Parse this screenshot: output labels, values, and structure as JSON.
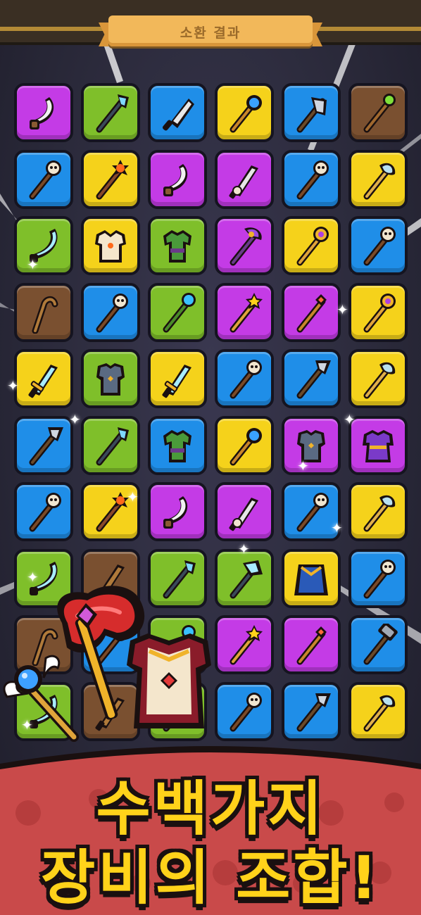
{
  "header": {
    "title": "소환 결과"
  },
  "headline": {
    "line1": "수백가지",
    "line2": "장비의 조합!"
  },
  "colors": {
    "purple": "#c43be6",
    "green": "#7fbf2a",
    "blue": "#1f8ee8",
    "yellow": "#f5d21b",
    "brown": "#7a5030",
    "banner": "#c94a4a",
    "headline": "#ffd21a"
  },
  "grid": {
    "rows": [
      [
        {
          "color": "purple",
          "item": "scimitar-icon"
        },
        {
          "color": "green",
          "item": "ice-spear-icon"
        },
        {
          "color": "blue",
          "item": "cleaver-icon"
        },
        {
          "color": "yellow",
          "item": "star-scepter-icon"
        },
        {
          "color": "blue",
          "item": "axe-icon"
        },
        {
          "color": "brown",
          "item": "green-orb-staff-icon"
        }
      ],
      [
        {
          "color": "blue",
          "item": "skull-staff-icon"
        },
        {
          "color": "yellow",
          "item": "sun-scepter-icon"
        },
        {
          "color": "purple",
          "item": "scimitar-icon"
        },
        {
          "color": "purple",
          "item": "skull-sword-icon"
        },
        {
          "color": "blue",
          "item": "skull-staff-icon"
        },
        {
          "color": "yellow",
          "item": "battle-axe-icon"
        }
      ],
      [
        {
          "color": "green",
          "item": "ice-scimitar-icon"
        },
        {
          "color": "yellow",
          "item": "armor-icon"
        },
        {
          "color": "green",
          "item": "tunic-icon"
        },
        {
          "color": "purple",
          "item": "orb-axe-staff-icon"
        },
        {
          "color": "yellow",
          "item": "moon-wand-icon"
        },
        {
          "color": "blue",
          "item": "skull-staff-icon"
        }
      ],
      [
        {
          "color": "brown",
          "item": "crook-staff-icon"
        },
        {
          "color": "blue",
          "item": "skull-staff-icon"
        },
        {
          "color": "green",
          "item": "vine-orb-staff-icon"
        },
        {
          "color": "purple",
          "item": "star-wand-icon"
        },
        {
          "color": "purple",
          "item": "winged-wand-icon"
        },
        {
          "color": "yellow",
          "item": "moon-wand-icon"
        }
      ],
      [
        {
          "color": "yellow",
          "item": "gold-sword-icon"
        },
        {
          "color": "green",
          "item": "chestplate-icon"
        },
        {
          "color": "yellow",
          "item": "gold-sword-icon"
        },
        {
          "color": "blue",
          "item": "skull-staff-icon"
        },
        {
          "color": "blue",
          "item": "spear-icon"
        },
        {
          "color": "yellow",
          "item": "battle-axe-icon"
        }
      ],
      [
        {
          "color": "blue",
          "item": "spear-icon"
        },
        {
          "color": "green",
          "item": "ice-spear-icon"
        },
        {
          "color": "blue",
          "item": "tunic-icon"
        },
        {
          "color": "yellow",
          "item": "star-scepter-icon"
        },
        {
          "color": "purple",
          "item": "chestplate-icon"
        },
        {
          "color": "purple",
          "item": "robe-icon"
        }
      ],
      [
        {
          "color": "blue",
          "item": "skull-staff-icon"
        },
        {
          "color": "yellow",
          "item": "sun-scepter-icon"
        },
        {
          "color": "purple",
          "item": "scimitar-icon"
        },
        {
          "color": "purple",
          "item": "skull-sword-icon"
        },
        {
          "color": "blue",
          "item": "skull-staff-icon"
        },
        {
          "color": "yellow",
          "item": "battle-axe-icon"
        }
      ],
      [
        {
          "color": "green",
          "item": "ice-scimitar-icon"
        },
        {
          "color": "brown",
          "item": "wooden-sword-icon"
        },
        {
          "color": "green",
          "item": "ice-spear-icon"
        },
        {
          "color": "green",
          "item": "ice-axe-icon"
        },
        {
          "color": "yellow",
          "item": "cloak-icon"
        },
        {
          "color": "blue",
          "item": "skull-staff-icon"
        }
      ],
      [
        {
          "color": "brown",
          "item": "crook-staff-icon"
        },
        {
          "color": "blue",
          "item": "skull-staff-icon"
        },
        {
          "color": "green",
          "item": "vine-orb-staff-icon"
        },
        {
          "color": "purple",
          "item": "star-wand-icon"
        },
        {
          "color": "purple",
          "item": "winged-wand-icon"
        },
        {
          "color": "blue",
          "item": "hammer-icon"
        }
      ],
      [
        {
          "color": "green",
          "item": "ice-scimitar-icon"
        },
        {
          "color": "brown",
          "item": "wooden-sword-icon"
        },
        {
          "color": "green",
          "item": "ice-spear-icon"
        },
        {
          "color": "blue",
          "item": "skull-staff-icon"
        },
        {
          "color": "blue",
          "item": "spear-icon"
        },
        {
          "color": "yellow",
          "item": "battle-axe-icon"
        }
      ]
    ]
  }
}
